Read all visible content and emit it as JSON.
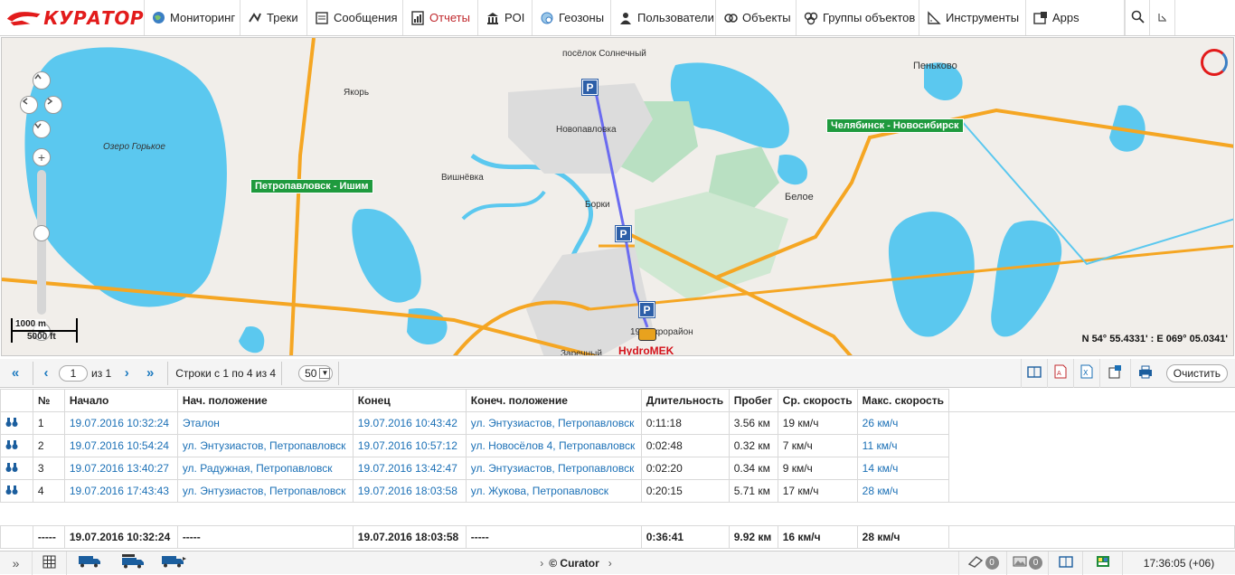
{
  "app": {
    "logo_text": "КУРАТОР"
  },
  "nav": {
    "items": [
      {
        "label": "Мониторинг",
        "icon": "globe-icon"
      },
      {
        "label": "Треки",
        "icon": "track-icon"
      },
      {
        "label": "Сообщения",
        "icon": "messages-icon"
      },
      {
        "label": "Отчеты",
        "icon": "reports-icon",
        "active": true
      },
      {
        "label": "POI",
        "icon": "poi-icon"
      },
      {
        "label": "Геозоны",
        "icon": "geofence-icon"
      },
      {
        "label": "Пользователи",
        "icon": "users-icon"
      },
      {
        "label": "Объекты",
        "icon": "units-icon"
      },
      {
        "label": "Группы объектов",
        "icon": "unit-groups-icon"
      },
      {
        "label": "Инструменты",
        "icon": "tools-icon"
      },
      {
        "label": "Apps",
        "icon": "apps-icon"
      }
    ]
  },
  "map": {
    "coords": "N 54° 55.4331' : E 069° 05.0341'",
    "scale_m": "1000 m",
    "scale_ft": "5000 ft",
    "roads": {
      "r1": "Петропавловск - Ишим",
      "r2": "Челябинск - Новосибирск"
    },
    "places": {
      "p1": "посёлок Солнечный",
      "p2": "Пеньково",
      "p3": "Якорь",
      "p4": "Озеро Горькое",
      "p5": "Новопавловка",
      "p6": "Вишнёвка",
      "p7": "Белое",
      "p8": "Борки",
      "p9": "19 микрорайон",
      "p10": "Заречный"
    },
    "unit_label": "HydroMEK",
    "accent_route": "#6b6bf0",
    "water_color": "#5bc8ef",
    "road_color": "#f5a623"
  },
  "pager": {
    "page": "1",
    "of": "из 1",
    "rows": "Строки с 1 по 4 из 4",
    "per_page": "50",
    "clear": "Очистить"
  },
  "table": {
    "headers": [
      "№",
      "Начало",
      "Нач. положение",
      "Конец",
      "Конеч. положение",
      "Длительность",
      "Пробег",
      "Ср. скорость",
      "Макс. скорость"
    ],
    "rows": [
      [
        "1",
        "19.07.2016 10:32:24",
        "Эталон",
        "19.07.2016 10:43:42",
        "ул. Энтузиастов, Петропавловск",
        "0:11:18",
        "3.56 км",
        "19 км/ч",
        "26 км/ч"
      ],
      [
        "2",
        "19.07.2016 10:54:24",
        "ул. Энтузиастов, Петропавловск",
        "19.07.2016 10:57:12",
        "ул. Новосёлов 4, Петропавловск",
        "0:02:48",
        "0.32 км",
        "7 км/ч",
        "11 км/ч"
      ],
      [
        "3",
        "19.07.2016 13:40:27",
        "ул. Радужная, Петропавловск",
        "19.07.2016 13:42:47",
        "ул. Энтузиастов, Петропавловск",
        "0:02:20",
        "0.34 км",
        "9 км/ч",
        "14 км/ч"
      ],
      [
        "4",
        "19.07.2016 17:43:43",
        "ул. Энтузиастов, Петропавловск",
        "19.07.2016 18:03:58",
        "ул. Жукова, Петропавловск",
        "0:20:15",
        "5.71 км",
        "17 км/ч",
        "28 км/ч"
      ]
    ],
    "total": [
      "-----",
      "19.07.2016 10:32:24",
      "-----",
      "19.07.2016 18:03:58",
      "-----",
      "0:36:41",
      "9.92 км",
      "16 км/ч",
      "28 км/ч"
    ]
  },
  "status": {
    "copyright": "© Curator",
    "counter1": "0",
    "counter2": "0",
    "time": "17:36:05 (+06)"
  }
}
